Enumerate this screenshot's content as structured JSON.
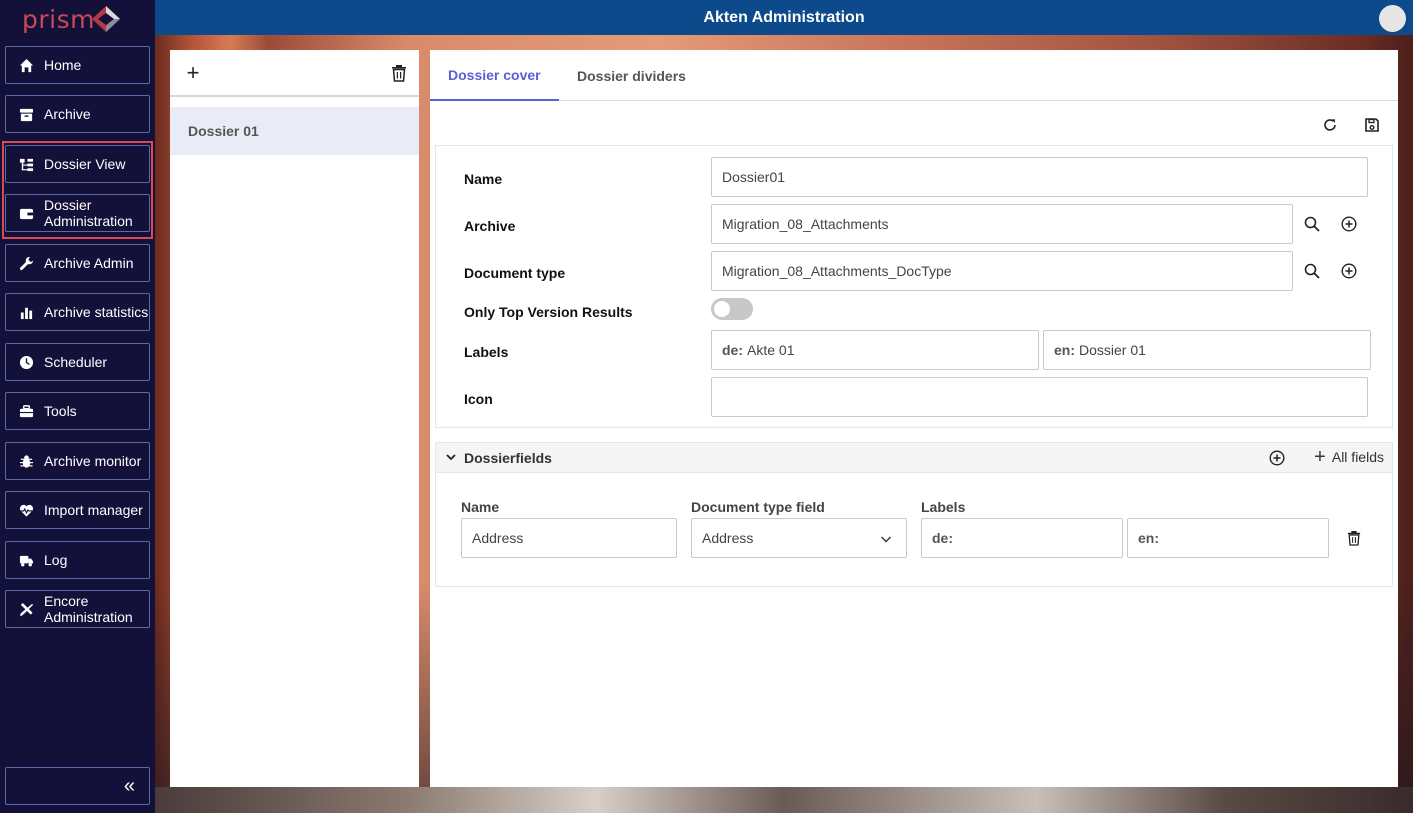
{
  "app": {
    "logo_text": "prism",
    "header_title": "Akten Administration"
  },
  "sidebar": {
    "items": [
      {
        "label": "Home",
        "icon": "home-icon"
      },
      {
        "label": "Archive",
        "icon": "archive-icon"
      },
      {
        "label": "Dossier View",
        "icon": "tree-icon"
      },
      {
        "label": "Dossier Administration",
        "icon": "wallet-icon"
      },
      {
        "label": "Archive Admin",
        "icon": "wrench-icon"
      },
      {
        "label": "Archive statistics",
        "icon": "bar-chart-icon"
      },
      {
        "label": "Scheduler",
        "icon": "clock-icon"
      },
      {
        "label": "Tools",
        "icon": "toolbox-icon"
      },
      {
        "label": "Archive monitor",
        "icon": "bug-icon"
      },
      {
        "label": "Import manager",
        "icon": "heartbeat-icon"
      },
      {
        "label": "Log",
        "icon": "truck-icon"
      },
      {
        "label": "Encore Administration",
        "icon": "tools-cross-icon"
      }
    ],
    "collapse_label": "«"
  },
  "list": {
    "items": [
      "Dossier 01"
    ]
  },
  "tabs": [
    {
      "label": "Dossier cover",
      "active": true
    },
    {
      "label": "Dossier dividers",
      "active": false
    }
  ],
  "form": {
    "name_label": "Name",
    "name_value": "Dossier01",
    "archive_label": "Archive",
    "archive_value": "Migration_08_Attachments",
    "doctype_label": "Document type",
    "doctype_value": "Migration_08_Attachments_DocType",
    "topversion_label": "Only Top Version Results",
    "topversion_on": false,
    "labels_label": "Labels",
    "label_de_prefix": "de:",
    "label_de_value": "Akte 01",
    "label_en_prefix": "en:",
    "label_en_value": "Dossier 01",
    "icon_label": "Icon",
    "icon_value": ""
  },
  "dossierfields": {
    "title": "Dossierfields",
    "all_fields_label": "All fields",
    "col_name": "Name",
    "col_doctype_field": "Document type field",
    "col_labels": "Labels",
    "rows": [
      {
        "name": "Address",
        "doctype_field": "Address",
        "de_prefix": "de:",
        "de_value": "",
        "en_prefix": "en:",
        "en_value": ""
      }
    ]
  },
  "colors": {
    "accent": "#5a5fd4",
    "header": "#0d4a8c",
    "sidebar": "#13103a",
    "highlight": "#d94a52"
  }
}
